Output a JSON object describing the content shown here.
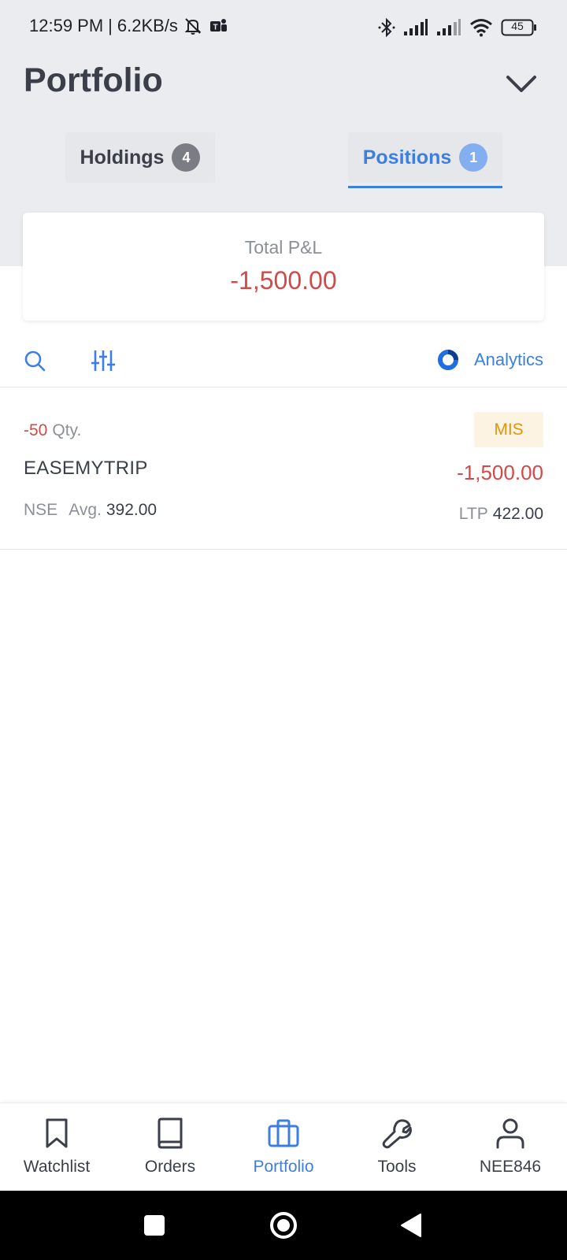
{
  "status_bar": {
    "time": "12:59 PM",
    "separator": "|",
    "net_speed": "6.2KB/s",
    "battery": "45"
  },
  "header": {
    "title": "Portfolio"
  },
  "tabs": [
    {
      "label": "Holdings",
      "count": "4",
      "active": false
    },
    {
      "label": "Positions",
      "count": "1",
      "active": true
    }
  ],
  "pnl_card": {
    "label": "Total P&L",
    "value": "-1,500.00"
  },
  "toolbar": {
    "analytics_label": "Analytics"
  },
  "positions": [
    {
      "qty": "-50",
      "qty_label": "Qty.",
      "symbol": "EASEMYTRIP",
      "exchange": "NSE",
      "avg_label": "Avg.",
      "avg": "392.00",
      "product": "MIS",
      "pnl": "-1,500.00",
      "ltp_label": "LTP",
      "ltp": "422.00"
    }
  ],
  "bottom_nav": [
    {
      "label": "Watchlist",
      "icon": "bookmark-icon",
      "active": false
    },
    {
      "label": "Orders",
      "icon": "book-icon",
      "active": false
    },
    {
      "label": "Portfolio",
      "icon": "briefcase-icon",
      "active": true
    },
    {
      "label": "Tools",
      "icon": "wrench-icon",
      "active": false
    },
    {
      "label": "NEE846",
      "icon": "user-icon",
      "active": false
    }
  ],
  "colors": {
    "accent": "#3d7fe0",
    "loss": "#d04a4a",
    "mis": "#e0950c",
    "header_bg": "#ebecef"
  }
}
